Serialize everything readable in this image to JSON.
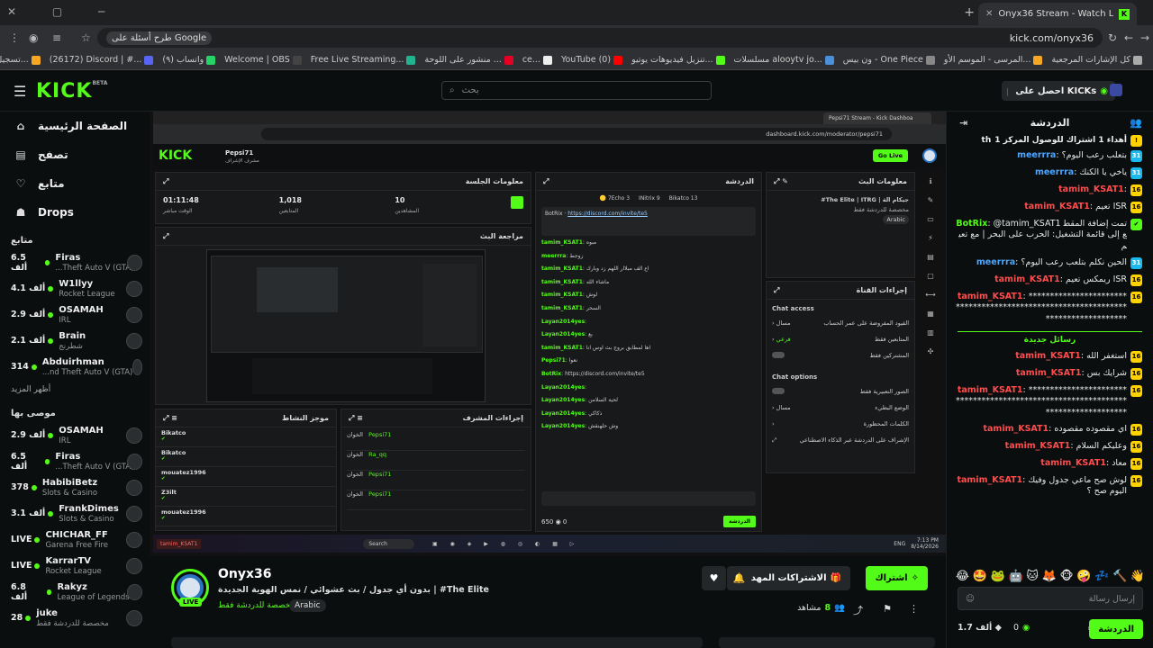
{
  "browser": {
    "tab_title": "Onyx36 Stream - Watch Live on",
    "tab_icon": "K",
    "url": "kick.com/onyx36",
    "google_chip": "طرح أسئلة على Google",
    "bookmarks": [
      {
        "label": "تسجيل الدخول - المو...",
        "color": "#f5a623"
      },
      {
        "label": "(26172) Discord | #...",
        "color": "#5865f2"
      },
      {
        "label": "(٩) واتساب",
        "color": "#25d366"
      },
      {
        "label": "Welcome | OBS",
        "color": "#444"
      },
      {
        "label": "Free Live Streaming...",
        "color": "#23b28f"
      },
      {
        "label": "منشور على اللوحة ...",
        "color": "#e60023"
      },
      {
        "label": "ce...",
        "color": "#eee"
      },
      {
        "label": "YouTube (0)",
        "color": "#ff0000"
      },
      {
        "label": "تنزيل فيديوهات يوتيو...",
        "color": "#53fc18"
      },
      {
        "label": "مسلسلات alooytv jo...",
        "color": "#4a90d9"
      },
      {
        "label": "ون بيس - One Piece",
        "color": "#888"
      },
      {
        "label": "المرسى - الموسم الأو...",
        "color": "#f5a623"
      },
      {
        "label": "كل الإشارات المرجعية",
        "color": "#aaa"
      }
    ]
  },
  "kick": {
    "logo": "KICK",
    "logo_beta": "BETA",
    "search_placeholder": "بحث",
    "get_kicks": "احصل على KICKs"
  },
  "sidebar": {
    "nav": [
      {
        "label": "الصفحة الرئيسية",
        "icon": "home-icon",
        "glyph": "⌂"
      },
      {
        "label": "تصفح",
        "icon": "browse-icon",
        "glyph": "▤"
      },
      {
        "label": "متابع",
        "icon": "heart-icon",
        "glyph": "♡"
      },
      {
        "label": "Drops",
        "icon": "drops-icon",
        "glyph": "☗"
      }
    ],
    "following_title": "متابع",
    "following": [
      {
        "name": "Firas",
        "game": "...Theft Auto V (GTA)",
        "viewers": "6.5 ألف"
      },
      {
        "name": "W1llyy",
        "game": "Rocket League",
        "viewers": "4.1 ألف"
      },
      {
        "name": "OSAMAH",
        "game": "IRL",
        "viewers": "2.9 ألف"
      },
      {
        "name": "Brain",
        "game": "شطرنج",
        "viewers": "2.1 ألف"
      },
      {
        "name": "Abduirhman",
        "game": "...nd Theft Auto V (GTA)",
        "viewers": "314"
      }
    ],
    "show_more": "أظهر المزيد",
    "recommended_title": "موصى بها",
    "recommended": [
      {
        "name": "OSAMAH",
        "game": "IRL",
        "viewers": "2.9 ألف"
      },
      {
        "name": "Firas",
        "game": "...Theft Auto V (GTA)",
        "viewers": "6.5 ألف"
      },
      {
        "name": "HabibiBetz",
        "game": "Slots & Casino",
        "viewers": "378"
      },
      {
        "name": "FrankDimes",
        "game": "Slots & Casino",
        "viewers": "3.1 ألف"
      },
      {
        "name": "CHICHAR_FF",
        "game": "Garena Free Fire",
        "viewers": "LIVE"
      },
      {
        "name": "KarrarTV",
        "game": "Rocket League",
        "viewers": "LIVE"
      },
      {
        "name": "Rakyz",
        "game": "League of Legends",
        "viewers": "6.8 ألف"
      },
      {
        "name": "juke",
        "game": "مخصصة للدردشة فقط",
        "viewers": "28"
      }
    ]
  },
  "video": {
    "inner_url": "dashboard.kick.com/moderator/pepsi71",
    "inner_tab": "Pepsi71 Stream - Kick Dashboa",
    "inner_channel": "Pepsi71",
    "inner_role": "مشرف الإشراف",
    "go_live": "Go Live",
    "session_title": "معلومات الجلسة",
    "stats": [
      {
        "value": "01:11:48",
        "label": "الوقت مباشر"
      },
      {
        "value": "1,018",
        "label": "المتابعين"
      },
      {
        "value": "10",
        "label": "المشاهدين"
      }
    ],
    "preview_title": "مراجعة البث",
    "chat_title": "الدردشة",
    "stream_info_title": "معلومات البث",
    "stream_info_text": "#The Elite | ITRG | جيكام الة",
    "stream_info_cat": "مخصصة للدردشة فقط",
    "stream_info_lang": "Arabic",
    "channel_actions_title": "إجراءات القناة",
    "chat_access": "Chat access",
    "chat_options": "Chat options",
    "activity_title": "موجز النشاط",
    "mod_actions_title": "إجراءات المشرف",
    "activity": [
      "Bikatco",
      "Bikatco",
      "mouatez1996",
      "Z3ilt",
      "mouatez1996"
    ],
    "inner_chat": [
      {
        "user": "tamim_KSAT1",
        "text": "مبوه"
      },
      {
        "user": "meerrra",
        "text": "زوجط"
      },
      {
        "user": "tamim_KSAT1",
        "text": "اع الف مبلاار اللهم زد وبارك"
      },
      {
        "user": "tamim_KSAT1",
        "text": "ماشاء الله"
      },
      {
        "user": "tamim_KSAT1",
        "text": "لوش"
      },
      {
        "user": "tamim_KSAT1",
        "text": "السحر"
      },
      {
        "user": "Layan2014yes",
        "text": ""
      },
      {
        "user": "Layan2014yes",
        "text": "بع"
      },
      {
        "user": "tamim_KSAT1",
        "text": "اها لمطابق بروج بث اوس انا"
      },
      {
        "user": "Pepsi71",
        "text": "نعوا"
      },
      {
        "user": "BotRix",
        "text": "https://discord.com/invite/te5"
      },
      {
        "user": "Layan2014yes",
        "text": ""
      },
      {
        "user": "Layan2014yes",
        "text": "لحية السلامن"
      },
      {
        "user": "Layan2014yes",
        "text": "ذكاكي"
      },
      {
        "user": "Layan2014yes",
        "text": "وش حلهنقش"
      }
    ],
    "taskbar_search": "Search",
    "taskbar_time": "7:13 PM",
    "taskbar_date": "8/14/2026",
    "taskbar_lang": "ENG"
  },
  "stream": {
    "channel": "Onyx36",
    "live": "LIVE",
    "title": "بدون أي جدول / بث عشوائي / نمس الهوية الجديدة | #The Elite",
    "category": "مخصصة للدردشة فقط",
    "language": "Arabic",
    "subscribe": "اشتراك",
    "gift_subs": "الاشتراكات المهداة",
    "viewers_label": "مشاهد",
    "viewers": "8"
  },
  "chat": {
    "title": "الدردشة",
    "pinned": "أهداء 1 اشتراك للوصول المركز 1",
    "pinned_count": "th",
    "new_messages": "رسائل جديدة",
    "messages": [
      {
        "badge": "31",
        "badge_color": "blue",
        "user": "meerrra",
        "user_color": "#4da6ff",
        "text": "بتعلب رعب اليوم؟"
      },
      {
        "badge": "31",
        "badge_color": "blue",
        "user": "meerrra",
        "user_color": "#4da6ff",
        "text": "ياخي يا الكنك"
      },
      {
        "badge": "16",
        "badge_color": "yellow",
        "user": "tamim_KSAT1",
        "user_color": "#ff4d4d",
        "text": ""
      },
      {
        "badge": "16",
        "badge_color": "yellow",
        "user": "tamim_KSAT1",
        "user_color": "#ff4d4d",
        "text": "تعيم ISR"
      },
      {
        "badge": "✔",
        "badge_color": "green",
        "user": "BotRix",
        "user_color": "#53fc18",
        "text": "@tamim_KSAT1 تمت إضافة المقطع إلى قائمة التشغيل: الحرب على البحر | مع تعيم"
      },
      {
        "badge": "31",
        "badge_color": "blue",
        "user": "meerrra",
        "user_color": "#4da6ff",
        "text": "الحين نكلم بتلعب رعب اليوم؟"
      },
      {
        "badge": "16",
        "badge_color": "yellow",
        "user": "tamim_KSAT1",
        "user_color": "#ff4d4d",
        "text": "ريمكس تعيم ISR"
      },
      {
        "badge": "16",
        "badge_color": "yellow",
        "user": "tamim_KSAT1",
        "user_color": "#ff4d4d",
        "text": "**********************************************************************************"
      }
    ],
    "messages_new": [
      {
        "badge": "16",
        "badge_color": "yellow",
        "user": "tamim_KSAT1",
        "user_color": "#ff4d4d",
        "text": "استغفر الله"
      },
      {
        "badge": "16",
        "badge_color": "yellow",
        "user": "tamim_KSAT1",
        "user_color": "#ff4d4d",
        "text": "شرايك بس"
      },
      {
        "badge": "16",
        "badge_color": "yellow",
        "user": "tamim_KSAT1",
        "user_color": "#ff4d4d",
        "text": "**********************************************************************************"
      },
      {
        "badge": "16",
        "badge_color": "yellow",
        "user": "tamim_KSAT1",
        "user_color": "#ff4d4d",
        "text": "اي مقصوده مقصوده"
      },
      {
        "badge": "16",
        "badge_color": "yellow",
        "user": "tamim_KSAT1",
        "user_color": "#ff4d4d",
        "text": "وعليكم السلام"
      },
      {
        "badge": "16",
        "badge_color": "yellow",
        "user": "tamim_KSAT1",
        "user_color": "#ff4d4d",
        "text": "معاد"
      },
      {
        "badge": "16",
        "badge_color": "yellow",
        "user": "tamim_KSAT1",
        "user_color": "#ff4d4d",
        "text": "لوش صح ماعي جدول وفيك اليوم صح ؟"
      }
    ],
    "emotes": [
      "😂",
      "🤩",
      "🐸",
      "🤖",
      "🐱",
      "🦊",
      "🐵",
      "🤪",
      "💤",
      "🔨",
      "👋"
    ],
    "input_placeholder": "إرسال رسالة",
    "send": "الدردشة",
    "points": "0",
    "kicks": "1.7 ألف"
  }
}
